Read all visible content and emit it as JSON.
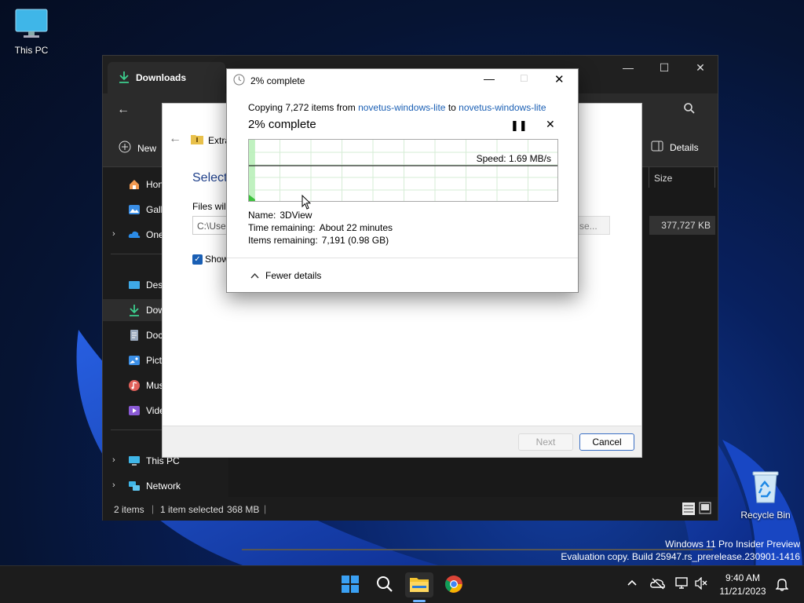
{
  "desktop": {
    "this_pc_label": "This PC",
    "recycle_bin_label": "Recycle Bin",
    "watermark_line1": "Windows 11 Pro Insider Preview",
    "watermark_line2": "Evaluation copy. Build 25947.rs_prerelease.230901-1416"
  },
  "explorer": {
    "tab_title": "Downloads",
    "new_label": "New",
    "details_label": "Details",
    "column_size": "Size",
    "row_size": "377,727 KB",
    "nav_items": [
      {
        "label": "Hon"
      },
      {
        "label": "Gall"
      },
      {
        "label": "One"
      },
      {
        "label": "Desl"
      },
      {
        "label": "Dow"
      },
      {
        "label": "Doc"
      },
      {
        "label": "Pict"
      },
      {
        "label": "Mus"
      },
      {
        "label": "Vide"
      },
      {
        "label": "This PC"
      },
      {
        "label": "Network"
      }
    ],
    "status": {
      "items": "2 items",
      "selected": "1 item selected",
      "size": "368 MB"
    }
  },
  "wizard": {
    "crumb": "Extra",
    "heading": "Select",
    "files_label": "Files will",
    "path_value": "C:\\User",
    "browse_label": "se...",
    "show_label": "Show",
    "show_checked": true,
    "next_label": "Next",
    "cancel_label": "Cancel"
  },
  "copy_dialog": {
    "title": "2% complete",
    "copy_prefix": "Copying 7,272 items from",
    "source": "novetus-windows-lite",
    "to_word": "to",
    "dest": "novetus-windows-lite",
    "percent_text": "2% complete",
    "progress_fraction": 0.02,
    "speed": "Speed: 1.69 MB/s",
    "name_label": "Name:",
    "name_value": "3DView",
    "time_label": "Time remaining:",
    "time_value": "About 22 minutes",
    "items_label": "Items remaining:",
    "items_value": "7,191 (0.98 GB)",
    "fewer_details": "Fewer details"
  },
  "taskbar": {
    "time": "9:40 AM",
    "date": "11/21/2023"
  },
  "colors": {
    "accent_blue": "#1a5fb4",
    "progress_green": "#3cc13c",
    "explorer_dark": "#1c1c1c"
  }
}
